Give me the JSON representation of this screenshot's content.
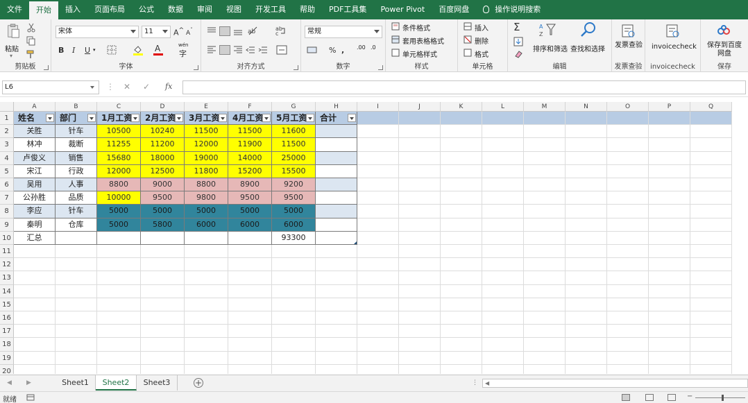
{
  "menu": {
    "tabs": [
      "文件",
      "开始",
      "插入",
      "页面布局",
      "公式",
      "数据",
      "审阅",
      "视图",
      "开发工具",
      "帮助",
      "PDF工具集",
      "Power Pivot",
      "百度网盘"
    ],
    "active": "开始",
    "tell_me": "操作说明搜索"
  },
  "ribbon": {
    "clipboard": {
      "paste": "粘贴",
      "label": "剪贴板"
    },
    "font": {
      "name": "宋体",
      "size": "11",
      "bold": "B",
      "italic": "I",
      "underline": "U",
      "grow": "A",
      "shrink": "A",
      "font_color": "A",
      "wen": "wén",
      "zi": "字",
      "label": "字体"
    },
    "alignment": {
      "label": "对齐方式"
    },
    "number": {
      "format": "常规",
      "percent": "%",
      "comma": ",",
      "label": "数字"
    },
    "styles": {
      "conditional": "条件格式",
      "table": "套用表格格式",
      "cell_styles": "单元格样式",
      "label": "样式"
    },
    "cells": {
      "insert": "插入",
      "delete": "删除",
      "format": "格式",
      "label": "单元格"
    },
    "editing": {
      "sort_filter": "排序和筛选",
      "find_select": "查找和选择",
      "label": "编辑"
    },
    "invoice": {
      "btn": "发票查验",
      "label": "发票查验"
    },
    "invoicecheck": {
      "btn": "invoicecheck",
      "label": "invoicecheck"
    },
    "save": {
      "btn": "保存到百度网盘",
      "label": "保存"
    }
  },
  "formula_bar": {
    "name_box": "L6",
    "fx": "fx",
    "value": ""
  },
  "columns": [
    "A",
    "B",
    "C",
    "D",
    "E",
    "F",
    "G",
    "H",
    "I",
    "J",
    "K",
    "L",
    "M",
    "N",
    "O",
    "P",
    "Q"
  ],
  "rows": [
    "1",
    "2",
    "3",
    "4",
    "5",
    "6",
    "7",
    "8",
    "9",
    "10",
    "11",
    "12",
    "13",
    "14",
    "15",
    "16",
    "17",
    "18",
    "19",
    "20",
    "21",
    "22",
    "23"
  ],
  "table": {
    "headers": [
      "姓名",
      "部门",
      "1月工资",
      "2月工资",
      "3月工资",
      "4月工资",
      "5月工资",
      "合计"
    ],
    "records": [
      {
        "name": "关胜",
        "dept": "针车",
        "vals": [
          "10500",
          "10240",
          "11500",
          "11500",
          "11600"
        ]
      },
      {
        "name": "林冲",
        "dept": "裁断",
        "vals": [
          "11255",
          "11200",
          "12000",
          "11900",
          "11500"
        ]
      },
      {
        "name": "卢俊义",
        "dept": "销售",
        "vals": [
          "15680",
          "18000",
          "19000",
          "14000",
          "25000"
        ]
      },
      {
        "name": "宋江",
        "dept": "行政",
        "vals": [
          "12000",
          "12500",
          "11800",
          "15200",
          "15500"
        ]
      },
      {
        "name": "吴用",
        "dept": "人事",
        "vals": [
          "8800",
          "9000",
          "8800",
          "8900",
          "9200"
        ]
      },
      {
        "name": "公孙胜",
        "dept": "品质",
        "vals": [
          "10000",
          "9500",
          "9800",
          "9500",
          "9500"
        ]
      },
      {
        "name": "李应",
        "dept": "针车",
        "vals": [
          "5000",
          "5000",
          "5000",
          "5000",
          "5000"
        ]
      },
      {
        "name": "秦明",
        "dept": "仓库",
        "vals": [
          "5000",
          "5800",
          "6000",
          "6000",
          "6000"
        ]
      }
    ],
    "total_label": "汇总",
    "total_value": "93300"
  },
  "colors": {
    "excel_green": "#217346",
    "band_blue": "#dce6f1",
    "header_blue": "#b8cce4",
    "yellow": "#ffff00",
    "pink": "#e6b8b7",
    "teal": "#31859c"
  },
  "sheets": {
    "tabs": [
      "Sheet1",
      "Sheet2",
      "Sheet3"
    ],
    "active": "Sheet2"
  },
  "status": {
    "text": "就绪"
  }
}
